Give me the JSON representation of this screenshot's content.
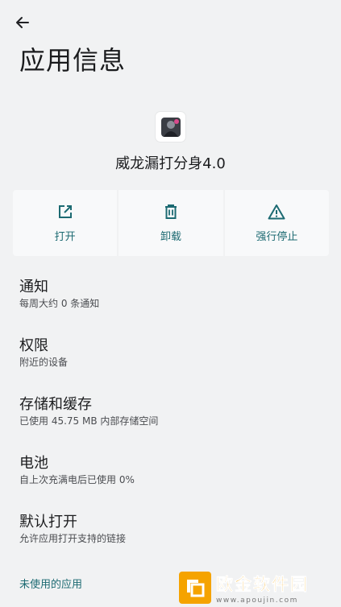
{
  "header": {
    "title": "应用信息",
    "back_icon": "arrow-left-icon"
  },
  "app": {
    "name": "威龙漏打分身4.0"
  },
  "actions": [
    {
      "label": "打开",
      "icon": "open-external-icon"
    },
    {
      "label": "卸载",
      "icon": "trash-icon"
    },
    {
      "label": "强行停止",
      "icon": "warning-icon"
    }
  ],
  "settings": [
    {
      "title": "通知",
      "subtitle": "每周大约 0 条通知"
    },
    {
      "title": "权限",
      "subtitle": "附近的设备"
    },
    {
      "title": "存储和缓存",
      "subtitle": "已使用 45.75 MB 内部存储空间"
    },
    {
      "title": "电池",
      "subtitle": "自上次充满电后已使用 0%"
    },
    {
      "title": "默认打开",
      "subtitle": "允许应用打开支持的链接"
    }
  ],
  "footer": {
    "unused_apps_label": "未使用的应用"
  },
  "watermark": {
    "name": "欧金软件园",
    "url": "www.apoujin.com"
  },
  "colors": {
    "accent": "#1c6a72",
    "background": "#f1f2f3",
    "card": "#f8f9fa",
    "watermark": "#f5a300"
  }
}
